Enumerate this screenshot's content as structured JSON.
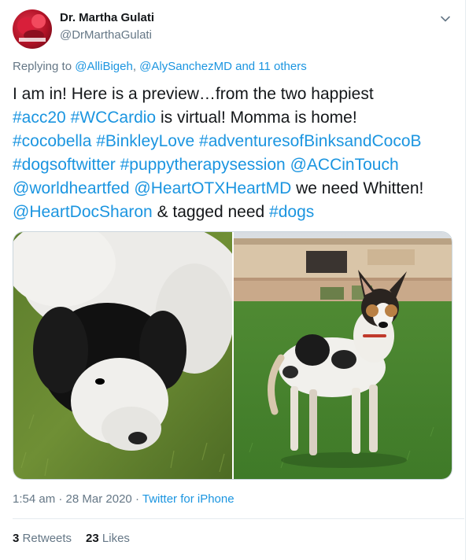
{
  "author": {
    "display_name": "Dr. Martha Gulati",
    "handle": "@DrMarthaGulati"
  },
  "reply_context": {
    "prefix": "Replying to",
    "mention_1": "@AlliBigeh",
    "separator": ",",
    "mention_2": "@AlySanchezMD",
    "and_others": "and 11 others"
  },
  "body": {
    "line1": "I am in! Here is a preview…from the two happiest",
    "line2_tag1": "#acc20",
    "line2_tag2": "#WCCardio",
    "line2_text": "is virtual! Momma is home!",
    "line3_tag1": "#cocobella",
    "line3_tag2": "#BinkleyLove",
    "line3_tag3": "#adventuresofBinksandCocoB",
    "line4_tag1": "#dogsoftwitter",
    "line4_tag2": "#puppytherapysession",
    "line4_tag3": "@ACCinTouch",
    "line5_tag1": "@worldheartfed",
    "line5_tag2": "@HeartOTXHeartMD",
    "line5_text": "we need Whitten!",
    "line6_tag1": "@HeartDocSharon",
    "line6_text": "& tagged need",
    "line6_tag2": "#dogs"
  },
  "meta": {
    "time": "1:54 am",
    "separator": "·",
    "date": "28 Mar 2020",
    "separator2": "·",
    "source": "Twitter for iPhone"
  },
  "stats": {
    "retweets_count": "3",
    "retweets_label": "Retweets",
    "likes_count": "23",
    "likes_label": "Likes"
  },
  "icons": {
    "menu": "chevron-down-icon"
  },
  "colors": {
    "link": "#1b95e0",
    "secondary_text": "#657786",
    "primary_text": "#14171a",
    "divider": "#e6ecf0"
  }
}
